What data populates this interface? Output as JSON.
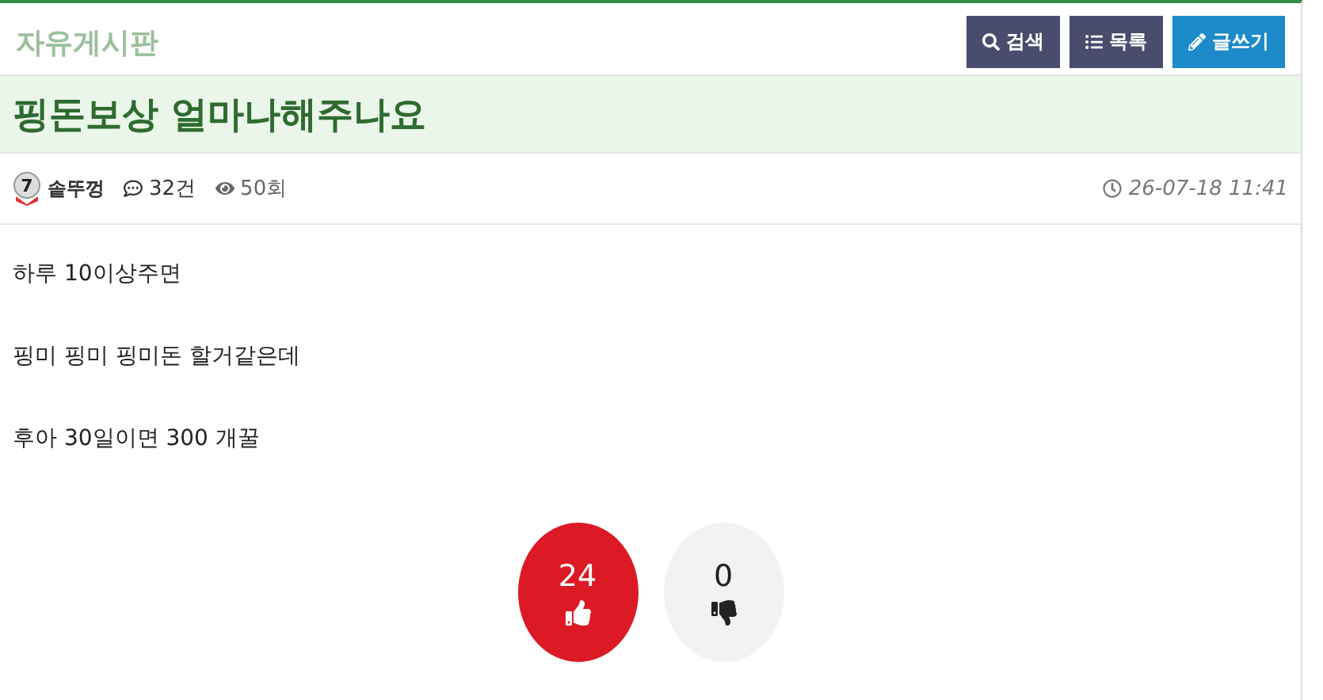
{
  "board": {
    "title": "자유게시판",
    "buttons": [
      {
        "kind": "search",
        "label": "검색"
      },
      {
        "kind": "list",
        "label": "목록"
      },
      {
        "kind": "write",
        "label": "글쓰기"
      }
    ]
  },
  "post": {
    "title": "핑돈보상 얼마나해주나요",
    "author": {
      "level": "7",
      "name": "솥뚜껑"
    },
    "comments": "32건",
    "views": "50회",
    "date": "26-07-18 11:41",
    "paragraphs": [
      "하루 10이상주면",
      "핑미 핑미 핑미돈 할거같은데",
      "후아 30일이면 300 개꿀"
    ],
    "votes": [
      {
        "kind": "up",
        "count": "24",
        "selected": true
      },
      {
        "kind": "down",
        "count": "0",
        "selected": false
      }
    ]
  }
}
